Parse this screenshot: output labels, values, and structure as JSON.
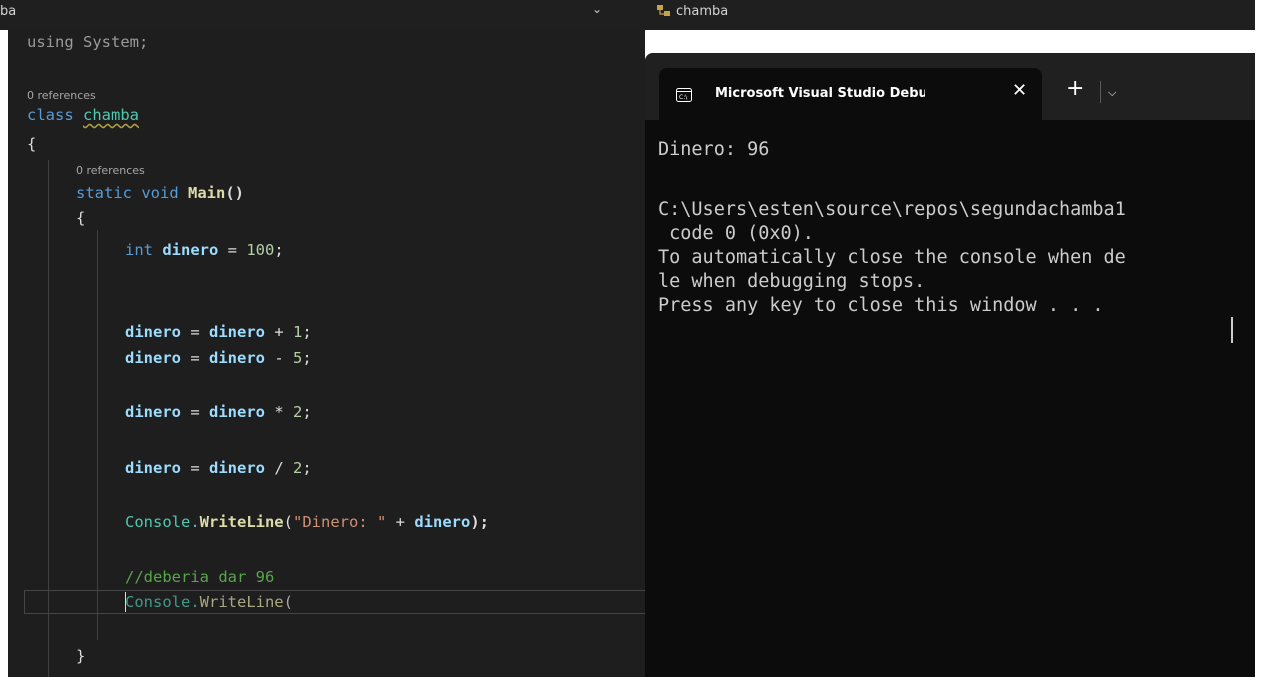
{
  "nav": {
    "left_text": "ba",
    "right_text": "chamba"
  },
  "editor": {
    "codelens": [
      "0 references",
      "0 references"
    ],
    "lines": {
      "using_kw": "using",
      "using_rest": " System;",
      "class_kw": "class ",
      "class_name": "chamba",
      "open_brace": "{",
      "method_mods": "static void ",
      "method_name": "Main",
      "method_parens": "()",
      "method_open": "{",
      "int_kw": "int ",
      "dinero": "dinero",
      "eq": " = ",
      "hundred": "100",
      "semi": ";",
      "add_op": " + ",
      "one": "1",
      "minus_op": " - ",
      "five": "5",
      "mul_op": " * ",
      "two": "2",
      "div_op": " / ",
      "console": "Console.",
      "writeline": "WriteLine",
      "open_paren": "(",
      "str_literal": "\"Dinero: \"",
      "close_paren_semi": ");",
      "comment": "//deberia dar 96",
      "incomplete_console": "Console.",
      "incomplete_writeline": "WriteLine",
      "incomplete_paren": "(",
      "method_close": "}"
    }
  },
  "terminal": {
    "tab_title": "Microsoft Visual Studio Debug Console",
    "new_tab": "+",
    "close_tab": "✕",
    "dropdown": "⌵",
    "output": [
      "Dinero: 96",
      "",
      "C:\\Users\\esten\\source\\repos\\segundachamba1",
      " code 0 (0x0).",
      "To automatically close the console when de",
      "le when debugging stops.",
      "Press any key to close this window . . ."
    ]
  }
}
